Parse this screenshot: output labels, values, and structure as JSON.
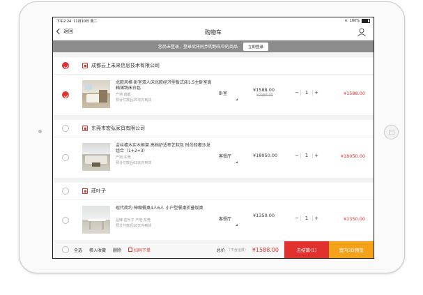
{
  "status": {
    "time": "下午2:24",
    "date": "11月10日 周二",
    "battery": "100%"
  },
  "nav": {
    "back_label": "返回",
    "title": "购物车"
  },
  "login_bar": {
    "message": "您尚未登录，登录后将同步购物车中的商品",
    "button": "立即登录"
  },
  "shops": [
    {
      "name": "成都云上未来信息技术有限公司",
      "checked": true,
      "items": [
        {
          "title": "北欧风格 卧室双人床北欧经济型板式床1.5主卧室高箱储物床白色",
          "origin": "产地:成都",
          "lead_time": "预计付款后25天内到货",
          "room": "卧室",
          "price": "¥1588.00",
          "original_price": "¥2188.00",
          "qty": "1",
          "subtotal": "¥1588.00",
          "checked": true
        }
      ]
    },
    {
      "name": "东莞市宏弘家具有限公司",
      "checked": false,
      "items": [
        {
          "title": "金丝檀木实木框架 高档舒适布艺软包 时尚轻奢沙发组合（1+2+3）",
          "origin": "产地:东莞",
          "lead_time": "预计付款后63天内到货",
          "room": "客餐厅",
          "price": "¥18050.00",
          "qty": "1",
          "subtotal": "¥18050.00",
          "checked": false
        }
      ]
    },
    {
      "name": "莊叶子",
      "checked": false,
      "items": [
        {
          "title": "现代简约 伸缩餐桌4人6人 小户型餐桌折叠饭桌",
          "origin": "品牌:莊叶子 产地:东莞",
          "lead_time": "预计付款后10天内到货",
          "room": "客餐厅",
          "price": "¥1350.00",
          "qty": "1",
          "subtotal": "¥1350.00",
          "checked": false
        }
      ]
    }
  ],
  "footer": {
    "select_all": "全选",
    "favorite": "移入收藏",
    "delete": "删除",
    "scan": "扫码下单",
    "total_label": "总价",
    "total_note": "（不含运费）",
    "total_value": "¥1588.00",
    "checkout": "去结算(1)",
    "view_3d": "室内3D预览"
  },
  "colors": {
    "accent": "#e0312f",
    "secondary": "#f5a21b",
    "login_bar": "#8c8c8c"
  }
}
